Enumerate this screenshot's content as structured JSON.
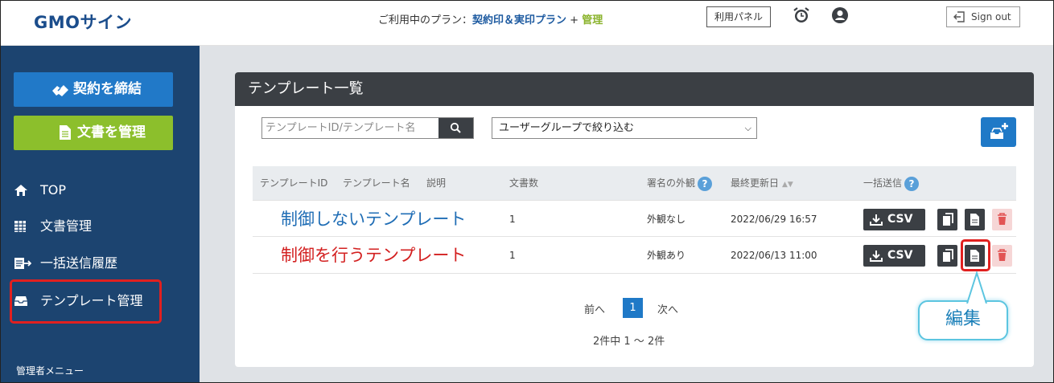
{
  "header": {
    "logo": "GMOサイン",
    "plan_prefix": "ご利用中のプラン：",
    "plan_name": "契約印＆実印プラン",
    "plan_plus": " + ",
    "plan_addon": "管理",
    "panel_button": "利用パネル",
    "alarm_icon": "alarm-clock-icon",
    "user_icon": "user-circle-icon",
    "signout": "Sign out"
  },
  "sidebar": {
    "contract_button": "契約を締結",
    "docs_button": "文書を管理",
    "items": [
      {
        "label": "TOP",
        "icon": "home-icon"
      },
      {
        "label": "文書管理",
        "icon": "table-icon"
      },
      {
        "label": "一括送信履歴",
        "icon": "bulk-send-icon"
      },
      {
        "label": "テンプレート管理",
        "icon": "template-tray-icon"
      }
    ],
    "admin_menu": "管理者メニュー"
  },
  "main": {
    "title": "テンプレート一覧",
    "search_placeholder": "テンプレートID/テンプレート名",
    "group_filter": "ユーザーグループで絞り込む",
    "columns": {
      "id": "テンプレートID",
      "name": "テンプレート名",
      "desc": "説明",
      "docs": "文書数",
      "appearance": "署名の外観",
      "updated": "最終更新日",
      "bulk": "一括送信"
    },
    "rows": [
      {
        "name": "制御しないテンプレート",
        "docs": "1",
        "appearance": "外観なし",
        "updated": "2022/06/29 16:57",
        "csv": "CSV"
      },
      {
        "name": "制御を行うテンプレート",
        "docs": "1",
        "appearance": "外観あり",
        "updated": "2022/06/13 11:00",
        "csv": "CSV"
      }
    ],
    "pagination": {
      "prev": "前へ",
      "current": "1",
      "next": "次へ",
      "summary": "2件中 1 ～ 2件"
    }
  },
  "callout": "編集",
  "colors": {
    "sidebar_bg": "#1c4470",
    "accent_blue": "#2179c8",
    "accent_green": "#8cbf2c",
    "highlight_red": "#e1201f",
    "header_dark": "#3b3f44"
  }
}
